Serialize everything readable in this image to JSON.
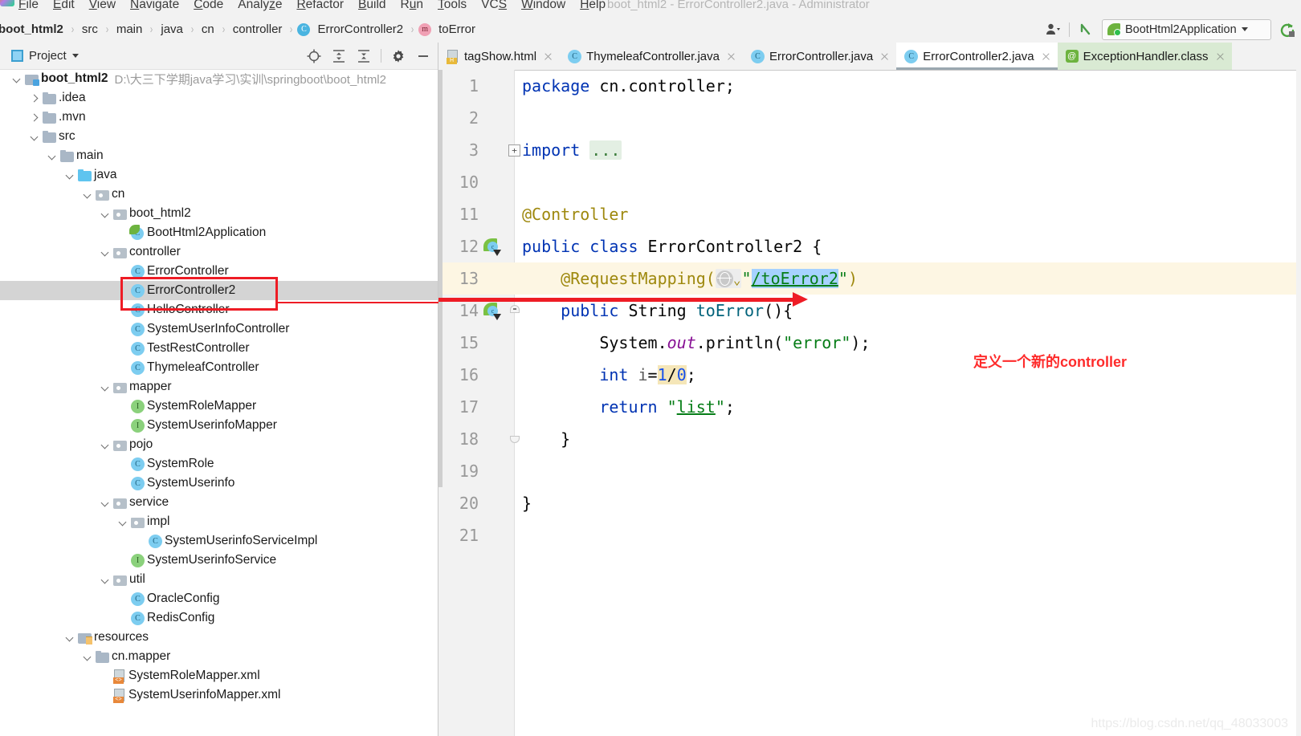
{
  "window": {
    "title": "boot_html2 - ErrorController2.java - Administrator",
    "logo_name": "intellij-idea-logo"
  },
  "menu": {
    "items": [
      {
        "label": "File",
        "mnemonic": "F"
      },
      {
        "label": "Edit",
        "mnemonic": "E"
      },
      {
        "label": "View",
        "mnemonic": "V"
      },
      {
        "label": "Navigate",
        "mnemonic": "N"
      },
      {
        "label": "Code",
        "mnemonic": "C"
      },
      {
        "label": "Analyze",
        "mnemonic": "z"
      },
      {
        "label": "Refactor",
        "mnemonic": "R"
      },
      {
        "label": "Build",
        "mnemonic": "B"
      },
      {
        "label": "Run",
        "mnemonic": "u"
      },
      {
        "label": "Tools",
        "mnemonic": "T"
      },
      {
        "label": "VCS",
        "mnemonic": "S"
      },
      {
        "label": "Window",
        "mnemonic": "W"
      },
      {
        "label": "Help",
        "mnemonic": "H"
      }
    ]
  },
  "breadcrumb": {
    "items": [
      {
        "label": "boot_html2",
        "icon": "",
        "bold": true
      },
      {
        "label": "src",
        "icon": "",
        "bold": false
      },
      {
        "label": "main",
        "icon": "",
        "bold": false
      },
      {
        "label": "java",
        "icon": "",
        "bold": false
      },
      {
        "label": "cn",
        "icon": "",
        "bold": false
      },
      {
        "label": "controller",
        "icon": "",
        "bold": false
      },
      {
        "label": "ErrorController2",
        "icon": "class",
        "bold": false
      },
      {
        "label": "toError",
        "icon": "method",
        "bold": false
      }
    ],
    "separator": "›"
  },
  "navbar_right": {
    "user_icon": "user-settings-icon",
    "back_icon": "back-arrow-icon",
    "run_config": {
      "label": "BootHtml2Application",
      "icon": "spring-boot-icon",
      "dropdown_icon": "chevron-down-icon"
    },
    "rerun_icon": "rerun-icon"
  },
  "project_panel": {
    "title": "Project",
    "title_icon": "project-view-icon",
    "dropdown_icon": "chevron-down-icon",
    "tools": [
      {
        "name": "locate-in-tree-icon",
        "glyph": "target"
      },
      {
        "name": "expand-all-icon",
        "glyph": "expand"
      },
      {
        "name": "collapse-all-icon",
        "glyph": "collapse"
      },
      {
        "name": "settings-gear-icon",
        "glyph": "gear"
      },
      {
        "name": "hide-panel-icon",
        "glyph": "minus"
      }
    ],
    "tree": [
      {
        "label": "boot_html2",
        "path": "D:\\大三下学期java学习\\实训\\springboot\\boot_html2",
        "indent": 0,
        "arrow": "d",
        "icon": "folder-mod",
        "bold": true,
        "selected": false
      },
      {
        "label": ".idea",
        "path": "",
        "indent": 1,
        "arrow": "r",
        "icon": "folder",
        "bold": false,
        "selected": false
      },
      {
        "label": ".mvn",
        "path": "",
        "indent": 1,
        "arrow": "r",
        "icon": "folder",
        "bold": false,
        "selected": false
      },
      {
        "label": "src",
        "path": "",
        "indent": 1,
        "arrow": "d",
        "icon": "folder",
        "bold": false,
        "selected": false
      },
      {
        "label": "main",
        "path": "",
        "indent": 2,
        "arrow": "d",
        "icon": "folder",
        "bold": false,
        "selected": false
      },
      {
        "label": "java",
        "path": "",
        "indent": 3,
        "arrow": "d",
        "icon": "folder-src",
        "bold": false,
        "selected": false
      },
      {
        "label": "cn",
        "path": "",
        "indent": 4,
        "arrow": "d",
        "icon": "folder-pkg",
        "bold": false,
        "selected": false
      },
      {
        "label": "boot_html2",
        "path": "",
        "indent": 5,
        "arrow": "d",
        "icon": "folder-pkg",
        "bold": false,
        "selected": false
      },
      {
        "label": "BootHtml2Application",
        "path": "",
        "indent": 6,
        "arrow": "none",
        "icon": "springcls",
        "bold": false,
        "selected": false
      },
      {
        "label": "controller",
        "path": "",
        "indent": 5,
        "arrow": "d",
        "icon": "folder-pkg",
        "bold": false,
        "selected": false
      },
      {
        "label": "ErrorController",
        "path": "",
        "indent": 6,
        "arrow": "none",
        "icon": "cls",
        "bold": false,
        "selected": false
      },
      {
        "label": "ErrorController2",
        "path": "",
        "indent": 6,
        "arrow": "none",
        "icon": "cls",
        "bold": false,
        "selected": true
      },
      {
        "label": "HelloController",
        "path": "",
        "indent": 6,
        "arrow": "none",
        "icon": "cls",
        "bold": false,
        "selected": false
      },
      {
        "label": "SystemUserInfoController",
        "path": "",
        "indent": 6,
        "arrow": "none",
        "icon": "cls",
        "bold": false,
        "selected": false
      },
      {
        "label": "TestRestController",
        "path": "",
        "indent": 6,
        "arrow": "none",
        "icon": "cls",
        "bold": false,
        "selected": false
      },
      {
        "label": "ThymeleafController",
        "path": "",
        "indent": 6,
        "arrow": "none",
        "icon": "cls",
        "bold": false,
        "selected": false
      },
      {
        "label": "mapper",
        "path": "",
        "indent": 5,
        "arrow": "d",
        "icon": "folder-pkg",
        "bold": false,
        "selected": false
      },
      {
        "label": "SystemRoleMapper",
        "path": "",
        "indent": 6,
        "arrow": "none",
        "icon": "iface",
        "bold": false,
        "selected": false
      },
      {
        "label": "SystemUserinfoMapper",
        "path": "",
        "indent": 6,
        "arrow": "none",
        "icon": "iface",
        "bold": false,
        "selected": false
      },
      {
        "label": "pojo",
        "path": "",
        "indent": 5,
        "arrow": "d",
        "icon": "folder-pkg",
        "bold": false,
        "selected": false
      },
      {
        "label": "SystemRole",
        "path": "",
        "indent": 6,
        "arrow": "none",
        "icon": "cls",
        "bold": false,
        "selected": false
      },
      {
        "label": "SystemUserinfo",
        "path": "",
        "indent": 6,
        "arrow": "none",
        "icon": "cls",
        "bold": false,
        "selected": false
      },
      {
        "label": "service",
        "path": "",
        "indent": 5,
        "arrow": "d",
        "icon": "folder-pkg",
        "bold": false,
        "selected": false
      },
      {
        "label": "impl",
        "path": "",
        "indent": 6,
        "arrow": "d",
        "icon": "folder-pkg",
        "bold": false,
        "selected": false
      },
      {
        "label": "SystemUserinfoServiceImpl",
        "path": "",
        "indent": 7,
        "arrow": "none",
        "icon": "cls",
        "bold": false,
        "selected": false
      },
      {
        "label": "SystemUserinfoService",
        "path": "",
        "indent": 6,
        "arrow": "none",
        "icon": "iface",
        "bold": false,
        "selected": false
      },
      {
        "label": "util",
        "path": "",
        "indent": 5,
        "arrow": "d",
        "icon": "folder-pkg",
        "bold": false,
        "selected": false
      },
      {
        "label": "OracleConfig",
        "path": "",
        "indent": 6,
        "arrow": "none",
        "icon": "cls",
        "bold": false,
        "selected": false
      },
      {
        "label": "RedisConfig",
        "path": "",
        "indent": 6,
        "arrow": "none",
        "icon": "cls",
        "bold": false,
        "selected": false
      },
      {
        "label": "resources",
        "path": "",
        "indent": 3,
        "arrow": "d",
        "icon": "folder-res",
        "bold": false,
        "selected": false
      },
      {
        "label": "cn.mapper",
        "path": "",
        "indent": 4,
        "arrow": "d",
        "icon": "folder",
        "bold": false,
        "selected": false
      },
      {
        "label": "SystemRoleMapper.xml",
        "path": "",
        "indent": 5,
        "arrow": "none",
        "icon": "xml",
        "bold": false,
        "selected": false
      },
      {
        "label": "SystemUserinfoMapper.xml",
        "path": "",
        "indent": 5,
        "arrow": "none",
        "icon": "xml",
        "bold": false,
        "selected": false
      }
    ]
  },
  "editor_tabs": [
    {
      "label": "tagShow.html",
      "icon": "html",
      "active": false,
      "highlight": false,
      "close_icon": "close-icon"
    },
    {
      "label": "ThymeleafController.java",
      "icon": "cls",
      "active": false,
      "highlight": false,
      "close_icon": "close-icon"
    },
    {
      "label": "ErrorController.java",
      "icon": "cls",
      "active": false,
      "highlight": false,
      "close_icon": "close-icon"
    },
    {
      "label": "ErrorController2.java",
      "icon": "cls",
      "active": true,
      "highlight": false,
      "close_icon": "close-icon"
    },
    {
      "label": "ExceptionHandler.class",
      "icon": "atcls",
      "active": false,
      "highlight": true,
      "close_icon": "close-icon"
    }
  ],
  "code": {
    "lines": [
      {
        "num": "1",
        "text": "package cn.controller;"
      },
      {
        "num": "2",
        "text": ""
      },
      {
        "num": "3",
        "text": "import ..."
      },
      {
        "num": "10",
        "text": ""
      },
      {
        "num": "11",
        "text": "@Controller"
      },
      {
        "num": "12",
        "text": "public class ErrorController2 {"
      },
      {
        "num": "13",
        "text": "    @RequestMapping(\"/toError2\")"
      },
      {
        "num": "14",
        "text": "    public String toError(){"
      },
      {
        "num": "15",
        "text": "        System.out.println(\"error\");"
      },
      {
        "num": "16",
        "text": "        int i=1/0;"
      },
      {
        "num": "17",
        "text": "        return \"list\";"
      },
      {
        "num": "18",
        "text": "    }"
      },
      {
        "num": "19",
        "text": ""
      },
      {
        "num": "20",
        "text": "}"
      },
      {
        "num": "21",
        "text": ""
      }
    ],
    "highlighted_line": "13",
    "selection": "/toError2",
    "fold_placeholder": "...",
    "warning_token": "1/0"
  },
  "annotations": {
    "box_target": "ErrorController2",
    "arrow_label": "points-to-request-mapping",
    "note_text": "定义一个新的controller",
    "note_color": "#fe2b2b"
  },
  "watermark": "https://blog.csdn.net/qq_48033003"
}
